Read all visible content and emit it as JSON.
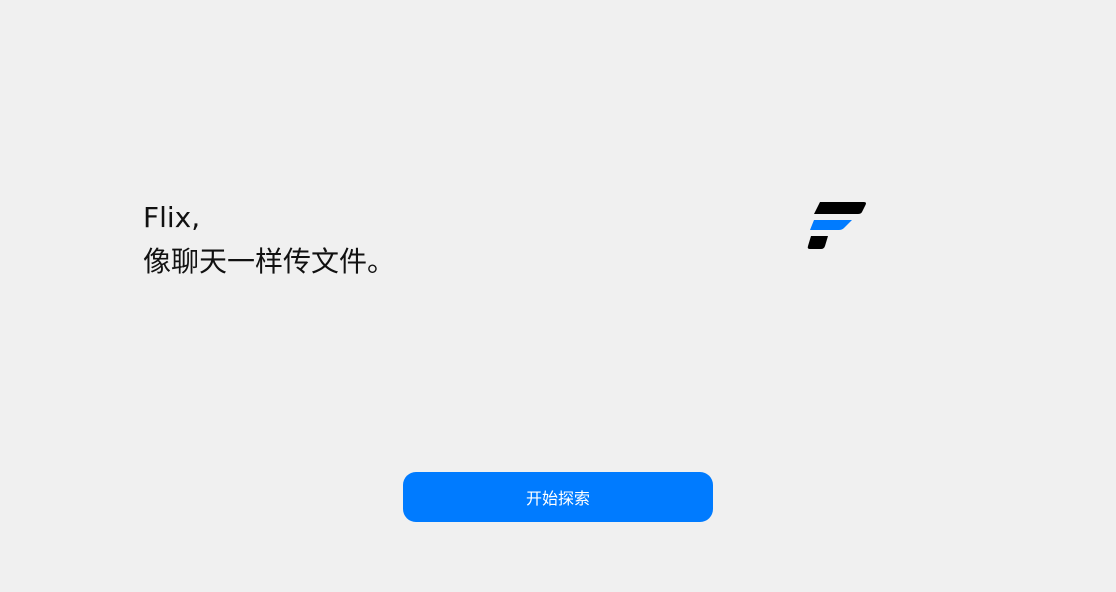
{
  "app": {
    "name_line": "Flix,",
    "tagline": "像聊天一样传文件。"
  },
  "logo": {
    "icon": "flix-logo-icon",
    "primary_color": "#000000",
    "accent_color": "#007bff"
  },
  "cta": {
    "label": "开始探索",
    "color": "#007bff"
  }
}
